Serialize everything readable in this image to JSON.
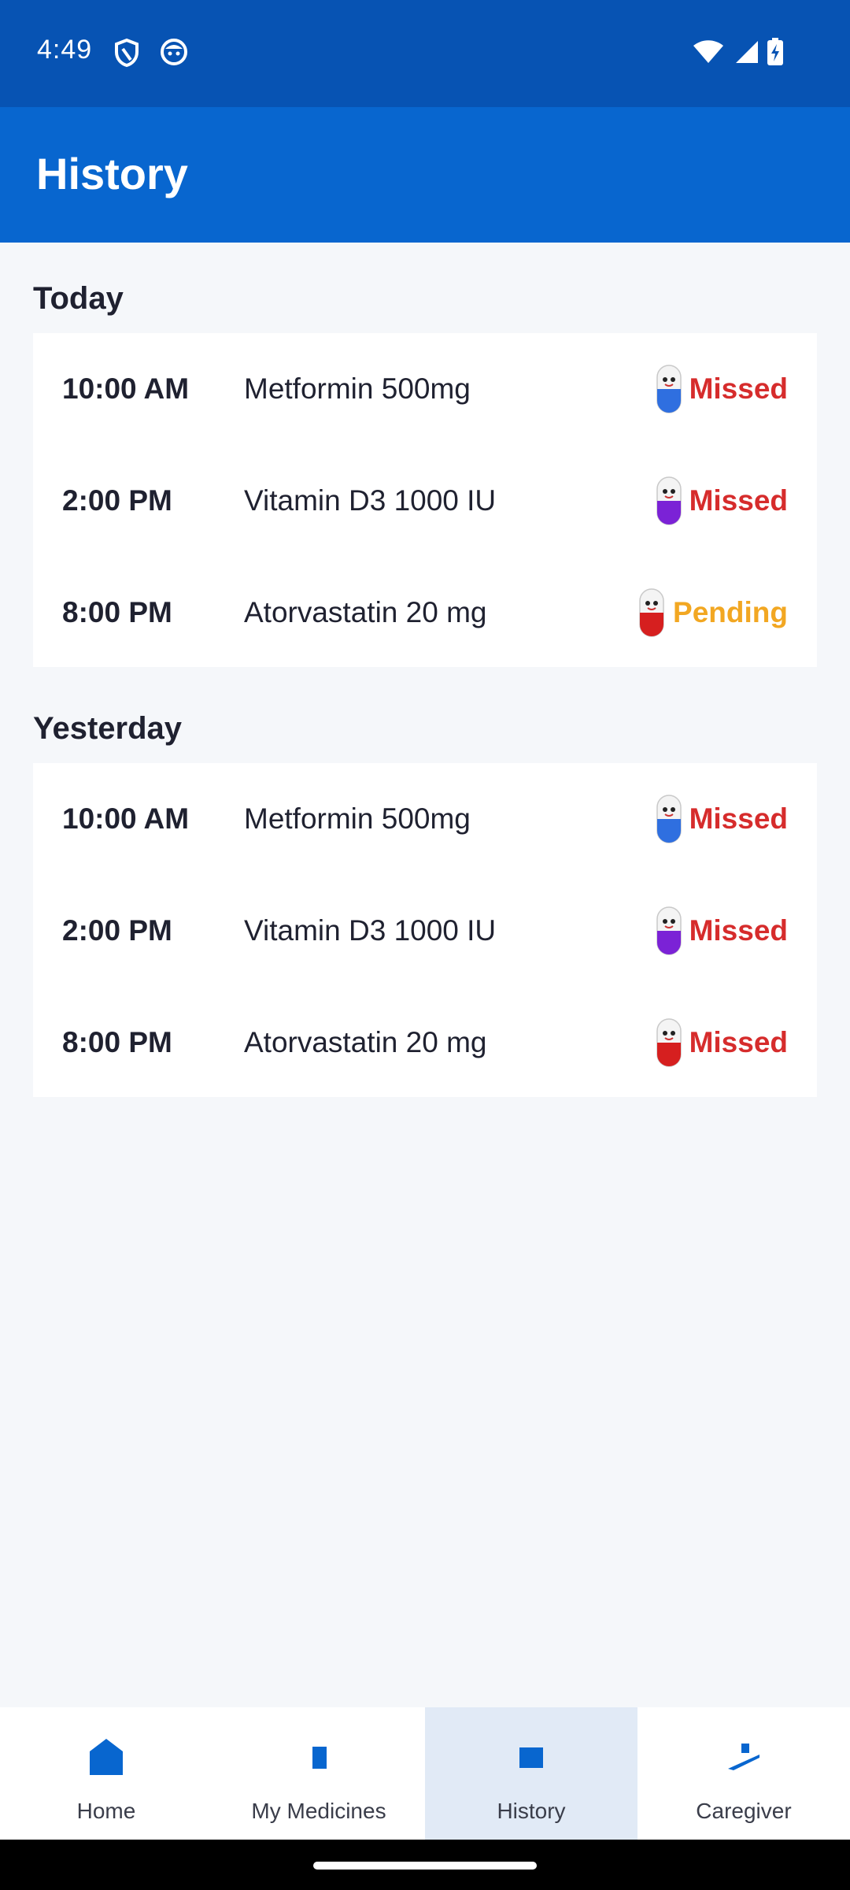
{
  "status_bar": {
    "time": "4:49",
    "icons": [
      "shield-icon",
      "face-icon",
      "wifi-icon",
      "signal-icon",
      "battery-charging-icon"
    ]
  },
  "app_bar": {
    "title": "History"
  },
  "colors": {
    "status_bar": "#0753b3",
    "app_bar": "#0866cf",
    "missed": "#d62c2c",
    "pending": "#f2a722",
    "nav_active_bg": "#e1eaf6",
    "nav_icon": "#0866cf"
  },
  "sections": [
    {
      "title": "Today",
      "entries": [
        {
          "time": "10:00 AM",
          "medicine": "Metformin 500mg",
          "status": "Missed",
          "pill_color": "#2f6fe0"
        },
        {
          "time": "2:00 PM",
          "medicine": "Vitamin D3 1000 IU",
          "status": "Missed",
          "pill_color": "#7b22d6"
        },
        {
          "time": "8:00 PM",
          "medicine": "Atorvastatin 20 mg",
          "status": "Pending",
          "pill_color": "#d61f1f"
        }
      ]
    },
    {
      "title": "Yesterday",
      "entries": [
        {
          "time": "10:00 AM",
          "medicine": "Metformin 500mg",
          "status": "Missed",
          "pill_color": "#2f6fe0"
        },
        {
          "time": "2:00 PM",
          "medicine": "Vitamin D3 1000 IU",
          "status": "Missed",
          "pill_color": "#7b22d6"
        },
        {
          "time": "8:00 PM",
          "medicine": "Atorvastatin 20 mg",
          "status": "Missed",
          "pill_color": "#d61f1f"
        }
      ]
    }
  ],
  "bottom_nav": {
    "items": [
      {
        "label": "Home",
        "icon": "home-icon",
        "active": false
      },
      {
        "label": "My Medicines",
        "icon": "medicine-icon",
        "active": false
      },
      {
        "label": "History",
        "icon": "history-icon",
        "active": true
      },
      {
        "label": "Caregiver",
        "icon": "caregiver-icon",
        "active": false
      }
    ]
  }
}
